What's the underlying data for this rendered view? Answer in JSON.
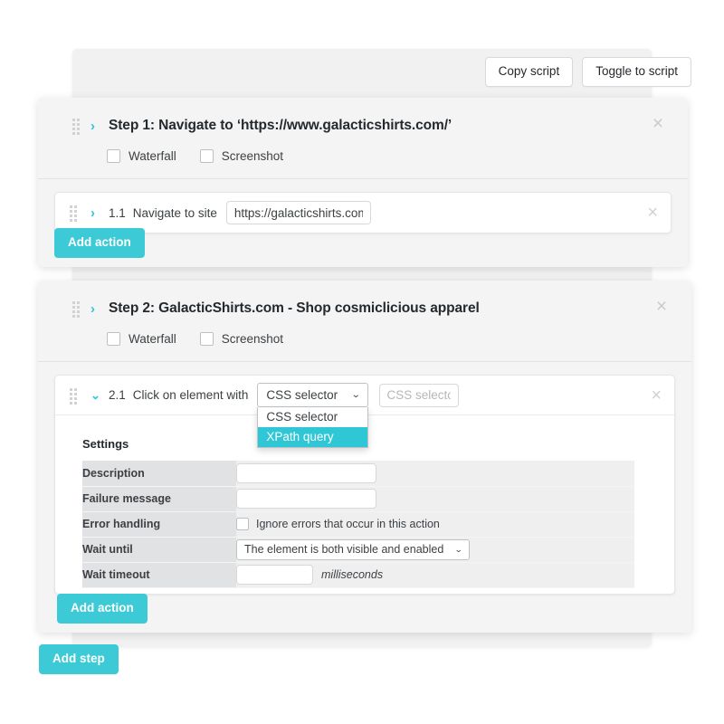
{
  "toolbar": {
    "copy_script_label": "Copy script",
    "toggle_script_label": "Toggle to script"
  },
  "accent_color": "#3ccbd6",
  "caret_color": "#2fc6d6",
  "steps": [
    {
      "id": "step-1",
      "caret": "›",
      "title": "Step 1: Navigate to ‘https://www.galacticshirts.com/’",
      "close_icon": "×",
      "options": [
        {
          "label": "Waterfall",
          "checked": false
        },
        {
          "label": "Screenshot",
          "checked": false
        }
      ],
      "actions": [
        {
          "number": "1.1",
          "caret": "›",
          "label": "Navigate to site",
          "value": "https://galacticshirts.com",
          "placeholder": "",
          "close_icon": "×",
          "expanded": false
        }
      ],
      "add_action_label": "Add action"
    },
    {
      "id": "step-2",
      "caret": "›",
      "title": "Step 2: GalacticShirts.com - Shop cosmiclicious apparel",
      "close_icon": "×",
      "options": [
        {
          "label": "Waterfall",
          "checked": false
        },
        {
          "label": "Screenshot",
          "checked": false
        }
      ],
      "actions": [
        {
          "number": "2.1",
          "caret": "⌄",
          "label": "Click on element with",
          "close_icon": "×",
          "expanded": true,
          "selector_type": {
            "selected": "CSS selector",
            "open": true,
            "chevron": "⌄",
            "options": [
              "CSS selector",
              "XPath query"
            ],
            "highlighted": "XPath query"
          },
          "selector_input": {
            "value": "",
            "placeholder": "CSS selector"
          },
          "settings": {
            "title": "Settings",
            "rows": [
              {
                "key": "Description",
                "type": "input",
                "value": "",
                "placeholder": ""
              },
              {
                "key": "Failure message",
                "type": "input",
                "value": "",
                "placeholder": ""
              },
              {
                "key": "Error handling",
                "type": "checkbox",
                "value": "Ignore errors that occur in this action",
                "checked": false
              },
              {
                "key": "Wait until",
                "type": "select",
                "value": "The element is both visible and enabled",
                "chevron": "⌄"
              },
              {
                "key": "Wait timeout",
                "type": "input-unit",
                "value": "",
                "placeholder": "",
                "unit": "milliseconds"
              }
            ]
          }
        }
      ],
      "add_action_label": "Add action"
    }
  ],
  "add_step_label": "Add step"
}
